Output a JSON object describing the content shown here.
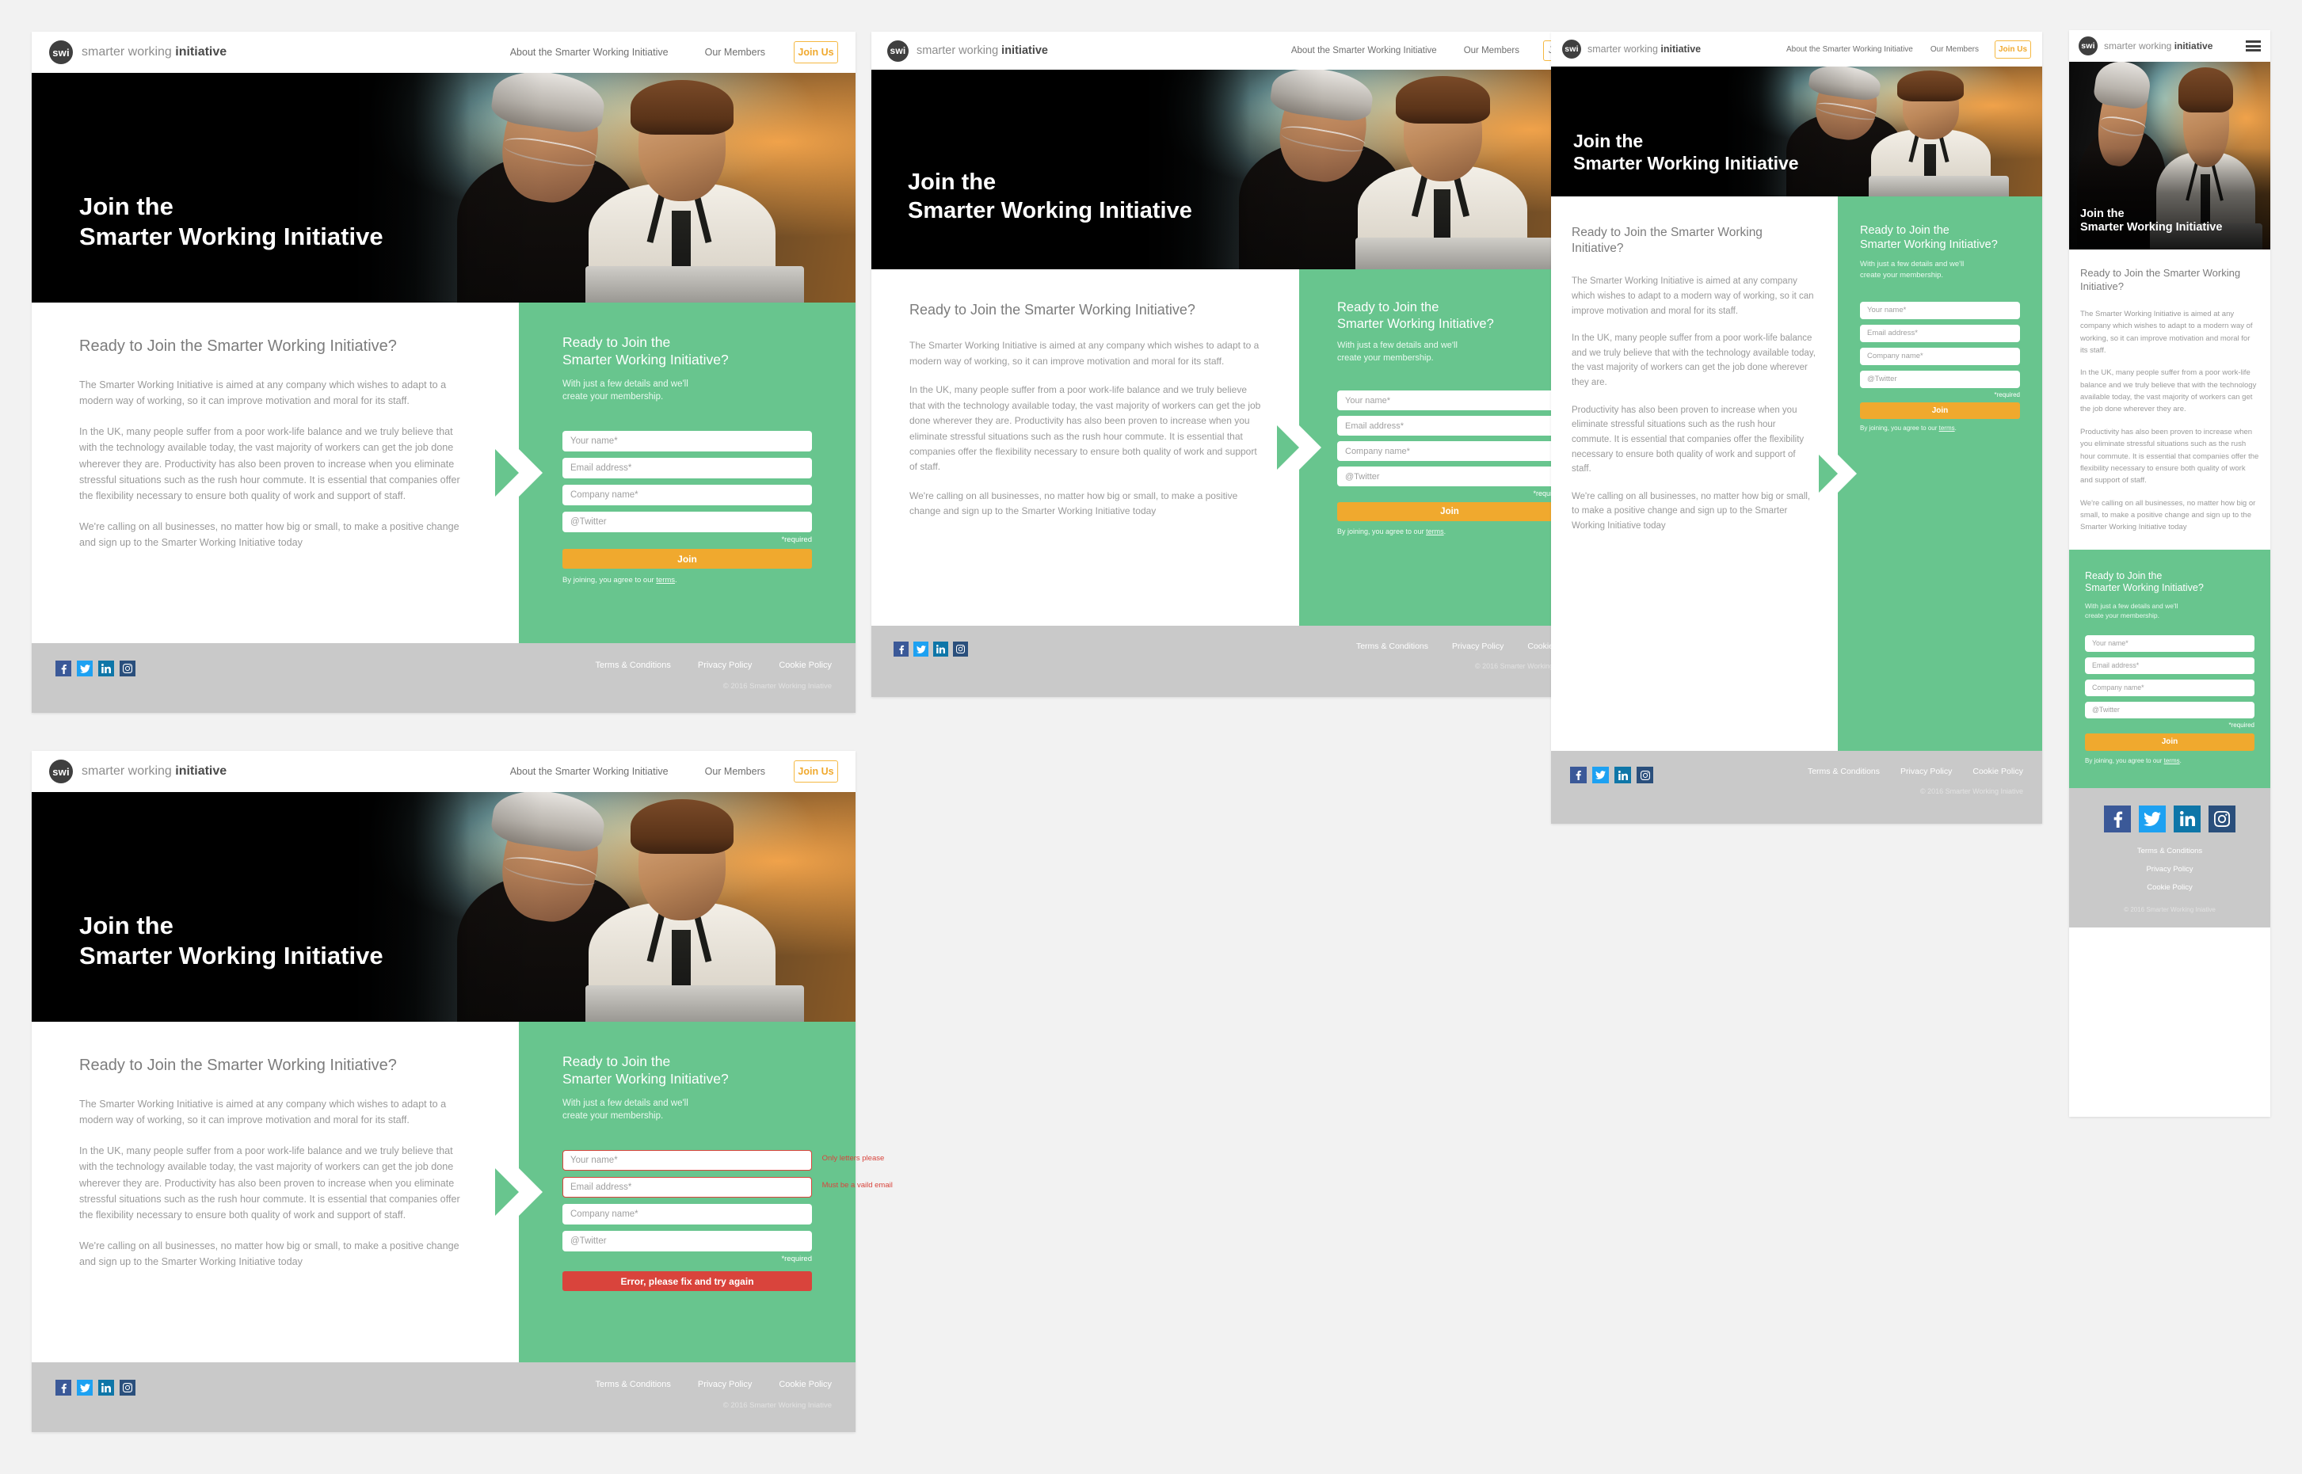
{
  "brand": {
    "badge": "swi",
    "name_light": "smarter working ",
    "name_bold": "initiative"
  },
  "nav": {
    "about": "About the Smarter Working Initiative",
    "members": "Our Members",
    "join": "Join Us",
    "menu_icon": "hamburger-icon"
  },
  "hero": {
    "line1": "Join the",
    "line2": "Smarter Working Initiative"
  },
  "content": {
    "heading": "Ready to Join the Smarter Working Initiative?",
    "p1": "The Smarter Working Initiative is aimed at any company which wishes to adapt to a modern way of working, so it can improve motivation and moral for its staff.",
    "p2": "In the UK, many people suffer from a poor work-life balance and we truly believe that with the technology available today, the vast majority of workers can get the job done wherever they are. Productivity has also been proven to increase when you eliminate stressful situations such as the rush hour commute. It is essential that companies offer the flexibility necessary to ensure both quality of work and support of staff.",
    "p3": "We're calling on all businesses, no matter how big or small, to make a positive change and sign up to the Smarter Working Initiative today",
    "p2a": "In the UK, many people suffer from a poor work-life balance and we truly believe that with the technology available today, the vast majority of workers can get the job done wherever they are.",
    "p2b": "Productivity has also been proven to increase when you eliminate stressful situations such as the rush hour commute. It is essential that companies offer the flexibility necessary to ensure both quality of work and support of staff."
  },
  "form": {
    "heading_line1": "Ready to Join the",
    "heading_line2": "Smarter Working Initiative?",
    "sub_line1": "With just a few details and we'll",
    "sub_line2": "create your membership.",
    "name_placeholder": "Your name*",
    "email_placeholder": "Email address*",
    "company_placeholder": "Company name*",
    "twitter_placeholder": "@Twitter",
    "required_note": "*required",
    "submit_label": "Join",
    "submit_error_label": "Error, please fix and try again",
    "terms_pre": "By joining, you agree to our ",
    "terms_link": "terms",
    "terms_post": ".",
    "error_name": "Only letters please",
    "error_email": "Must be a vaild email"
  },
  "footer": {
    "terms": "Terms & Conditions",
    "privacy": "Privacy Policy",
    "cookie": "Cookie Policy",
    "copyright": "© 2016 Smarter Working Iniative",
    "socials": [
      "facebook-icon",
      "twitter-icon",
      "linkedin-icon",
      "instagram-icon"
    ]
  },
  "colors": {
    "green": "#68c58e",
    "orange": "#f0a92e",
    "orange_border": "#f5b841",
    "red": "#d9443c",
    "page_bg": "#f2f2f2",
    "footer_bg": "#c9c9c9",
    "brand_dark": "#3f3f3f"
  }
}
